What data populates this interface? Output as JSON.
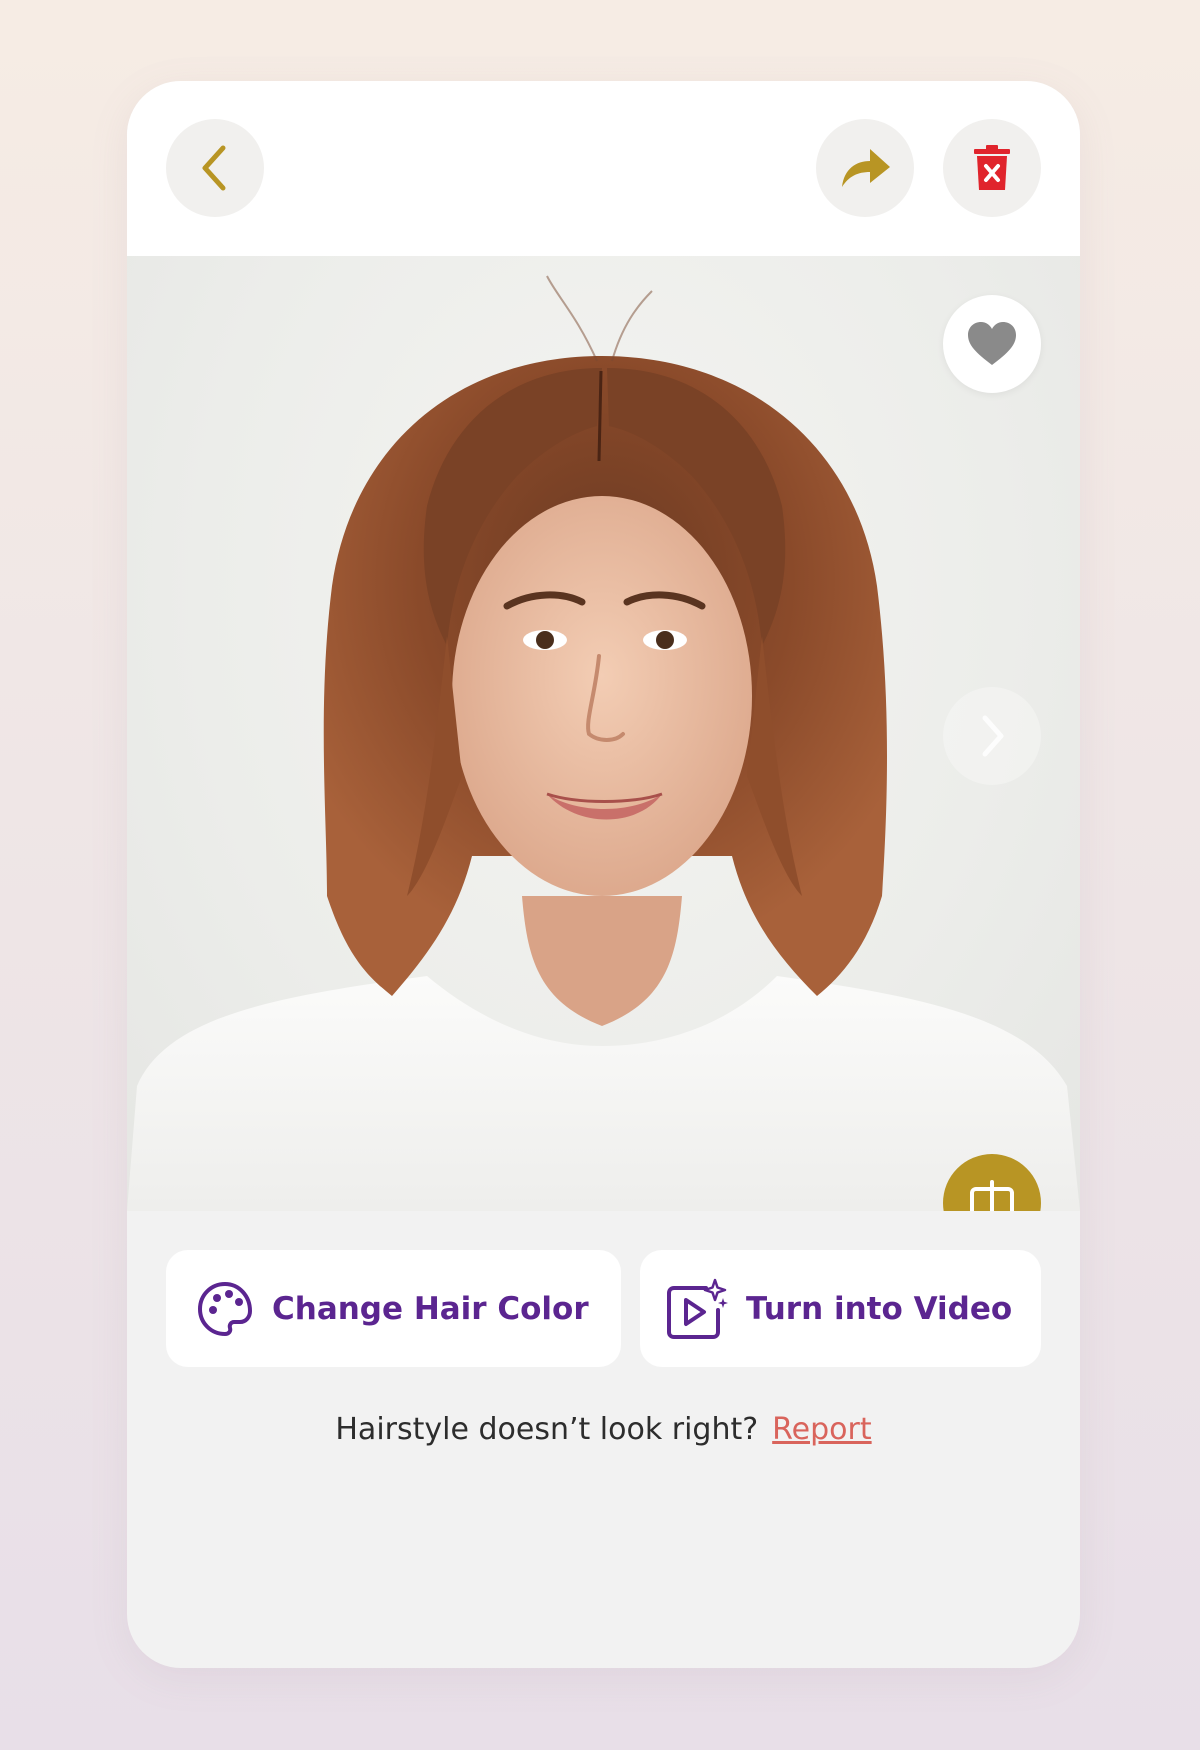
{
  "colors": {
    "accent_gold": "#b89524",
    "delete_red": "#e0242c",
    "action_purple": "#5b2590",
    "report_link": "#d9645c"
  },
  "header": {
    "back_icon": "chevron-left-icon",
    "share_icon": "share-arrow-icon",
    "delete_icon": "trash-icon"
  },
  "photo": {
    "favorite_icon": "heart-icon",
    "next_icon": "chevron-right-icon",
    "compare_icon": "compare-split-icon"
  },
  "actions": {
    "change_hair_color": {
      "label": "Change Hair Color",
      "icon": "palette-icon"
    },
    "turn_into_video": {
      "label": "Turn into Video",
      "icon": "video-sparkle-icon"
    }
  },
  "footer": {
    "question": "Hairstyle doesn’t look right?",
    "report_link": "Report"
  }
}
